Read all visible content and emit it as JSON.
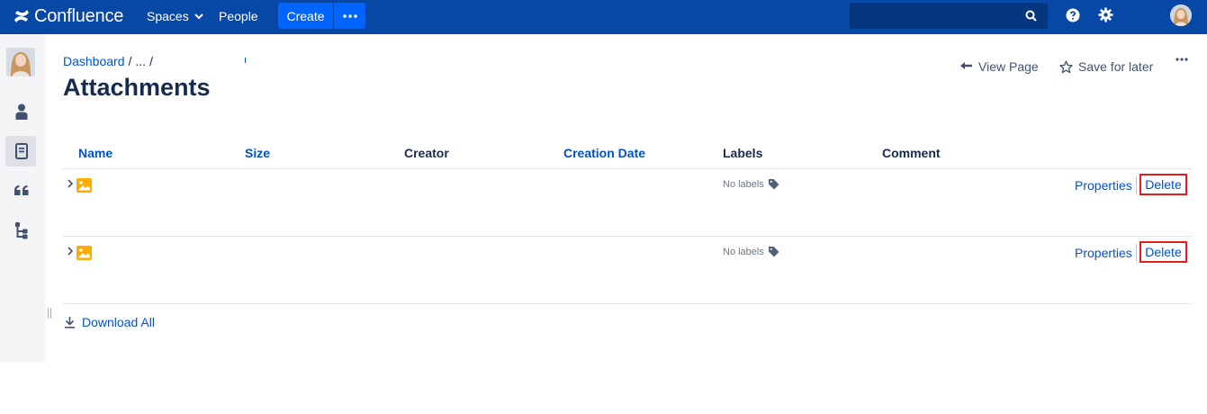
{
  "topnav": {
    "brand": "Confluence",
    "spaces_label": "Spaces",
    "people_label": "People",
    "create_label": "Create",
    "search_placeholder": ""
  },
  "breadcrumb": {
    "dashboard": "Dashboard",
    "ellipsis": "..."
  },
  "page": {
    "title": "Attachments"
  },
  "actions": {
    "view_page": "View Page",
    "save_for_later": "Save for later"
  },
  "table": {
    "columns": [
      {
        "label": "Name",
        "sortable": true
      },
      {
        "label": "Size",
        "sortable": true
      },
      {
        "label": "Creator",
        "sortable": false
      },
      {
        "label": "Creation Date",
        "sortable": true
      },
      {
        "label": "Labels",
        "sortable": false
      },
      {
        "label": "Comment",
        "sortable": false
      }
    ],
    "rows": [
      {
        "labels": "No labels",
        "properties": "Properties",
        "delete": "Delete"
      },
      {
        "labels": "No labels",
        "properties": "Properties",
        "delete": "Delete"
      }
    ]
  },
  "footer": {
    "download_all": "Download All"
  },
  "colors": {
    "nav_bg": "#0747A6",
    "create_bg": "#0065FF",
    "link": "#0052CC",
    "highlight": "#E01E1E",
    "image_icon": "#FFAB00"
  }
}
